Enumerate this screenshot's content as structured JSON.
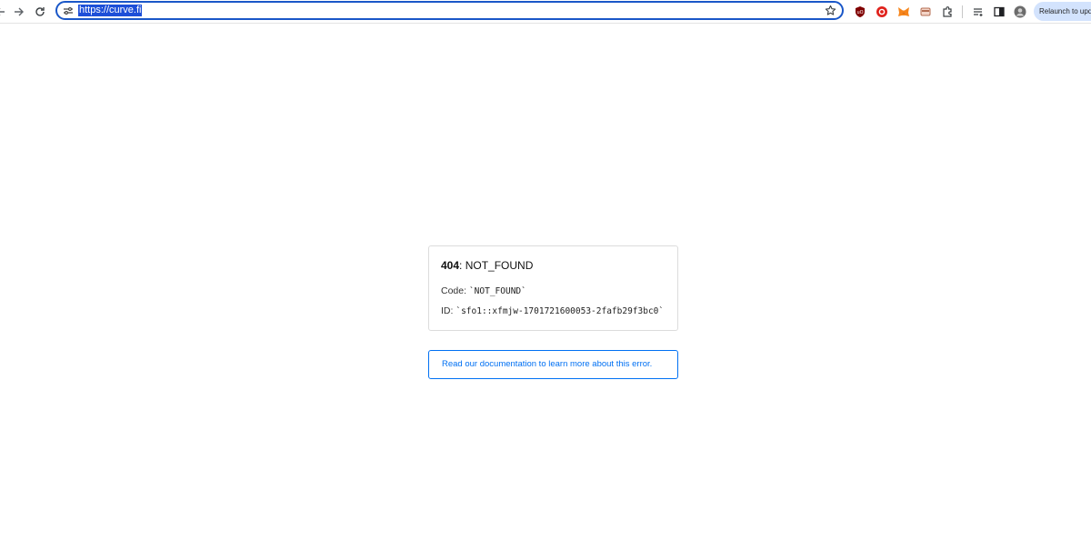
{
  "browser": {
    "url": "https://curve.fi",
    "relaunch_label": "Relaunch to upd",
    "icons": [
      "arrow-back-icon",
      "arrow-forward-icon",
      "reload-icon",
      "site-settings-icon",
      "bookmark-star-icon",
      "ublock-icon",
      "extension-red-icon",
      "metamask-icon",
      "extension-card-icon",
      "extensions-puzzle-icon",
      "reading-list-icon",
      "side-panel-icon",
      "profile-avatar"
    ],
    "colors": {
      "omnibox_border": "#1a57c8",
      "url_highlight": "#1d4fd8",
      "relaunch_bg": "#d3e3fd"
    }
  },
  "error": {
    "status_code": "404",
    "status_text": ": NOT_FOUND",
    "code_label": "Code: ",
    "code_value": "`NOT_FOUND`",
    "id_label": "ID: ",
    "id_value": "`sfo1::xfmjw-1701721600053-2fafb29f3bc0`",
    "doc_link": "Read our documentation to learn more about this error.",
    "colors": {
      "link": "#0070f3"
    }
  }
}
